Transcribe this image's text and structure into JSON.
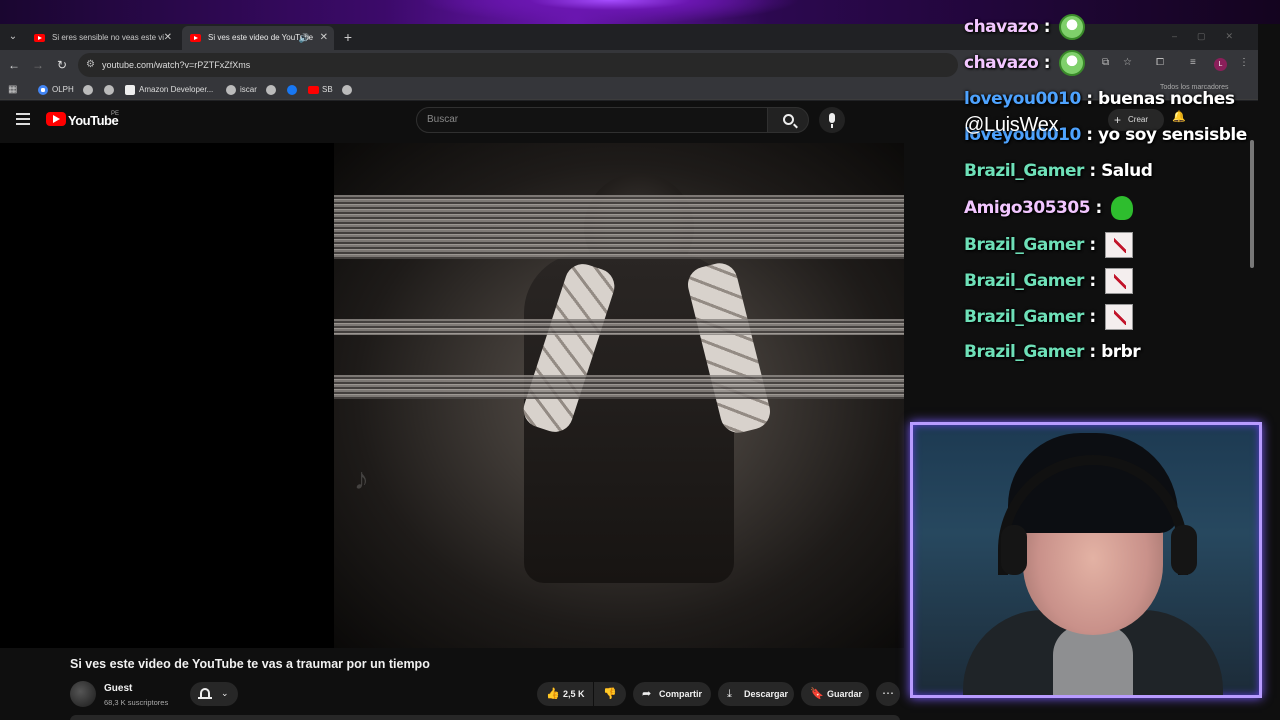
{
  "browser": {
    "tabs": [
      {
        "title": "Si eres sensible no veas este vi",
        "active": false
      },
      {
        "title": "Si ves este video de YouTube",
        "active": true
      }
    ],
    "url": "youtube.com/watch?v=rPZTFxZfXms",
    "bookmarks": [
      "OLPH",
      "Amazon Developer...",
      "iscar",
      "SB"
    ],
    "all_bookmarks": "Todos los marcadores",
    "profile_initial": "L"
  },
  "youtube": {
    "wordmark": "YouTube",
    "country": "PE",
    "search_placeholder": "Buscar",
    "create_label": "Crear",
    "video_title": "Si ves este video de YouTube te vas a traumar por un tiempo",
    "channel_name": "Guest",
    "subscribers": "68,3 K suscriptores",
    "likes": "2,5 K",
    "share_label": "Compartir",
    "download_label": "Descargar",
    "save_label": "Guardar"
  },
  "stream": {
    "handle": "@LuisWex",
    "chat": [
      {
        "user": "chavazo",
        "text": "",
        "emote": "face"
      },
      {
        "user": "chavazo",
        "text": "",
        "emote": "face"
      },
      {
        "user": "loveyou0010",
        "text": "buenas noches",
        "emote": ""
      },
      {
        "user": "loveyou0010",
        "text": "yo soy sensisble",
        "emote": ""
      },
      {
        "user": "Brazil_Gamer",
        "text": "Salud",
        "emote": ""
      },
      {
        "user": "Amigo305305",
        "text": "",
        "emote": "slime"
      },
      {
        "user": "Brazil_Gamer",
        "text": "",
        "emote": "sticker"
      },
      {
        "user": "Brazil_Gamer",
        "text": "",
        "emote": "sticker"
      },
      {
        "user": "Brazil_Gamer",
        "text": "",
        "emote": "sticker"
      },
      {
        "user": "Brazil_Gamer",
        "text": "brbr",
        "emote": ""
      }
    ]
  },
  "colors": {
    "chat_user_green": "#6ee0b8",
    "chat_user_pink": "#f2c6ff",
    "chat_user_blue": "#4ea3ff",
    "cam_border": "#b89bff",
    "youtube_red": "#ff0000"
  }
}
